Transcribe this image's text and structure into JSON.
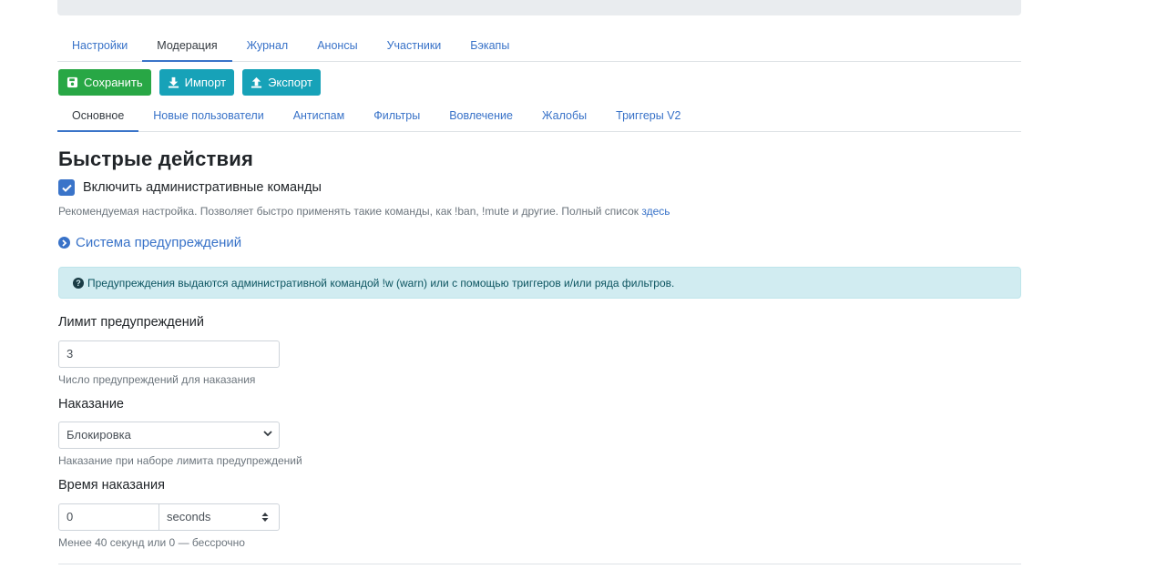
{
  "main_tabs": [
    {
      "label": "Настройки",
      "active": false
    },
    {
      "label": "Модерация",
      "active": true
    },
    {
      "label": "Журнал",
      "active": false
    },
    {
      "label": "Анонсы",
      "active": false
    },
    {
      "label": "Участники",
      "active": false
    },
    {
      "label": "Бэкапы",
      "active": false
    }
  ],
  "toolbar": {
    "save_label": "Сохранить",
    "import_label": "Импорт",
    "export_label": "Экспорт"
  },
  "sub_tabs": [
    {
      "label": "Основное",
      "active": true
    },
    {
      "label": "Новые пользователи",
      "active": false
    },
    {
      "label": "Антиспам",
      "active": false
    },
    {
      "label": "Фильтры",
      "active": false
    },
    {
      "label": "Вовлечение",
      "active": false
    },
    {
      "label": "Жалобы",
      "active": false
    },
    {
      "label": "Триггеры V2",
      "active": false
    }
  ],
  "quick_actions": {
    "heading": "Быстрые действия",
    "admin_commands_label": "Включить административные команды",
    "admin_commands_checked": true,
    "hint_text": "Рекомендуемая настройка. Позволяет быстро применять такие команды, как !ban, !mute и другие. Полный список ",
    "hint_link": "здесь"
  },
  "warnings": {
    "section_link": "Система предупреждений",
    "alert_text": "Предупреждения выдаются административной командой !w (warn) или с помощью триггеров и/или ряда фильтров.",
    "limit_label": "Лимит предупреждений",
    "limit_value": "3",
    "limit_hint": "Число предупреждений для наказания",
    "punishment_label": "Наказание",
    "punishment_value": "Блокировка",
    "punishment_hint": "Наказание при наборе лимита предупреждений",
    "duration_label": "Время наказания",
    "duration_value": "0",
    "duration_unit": "seconds",
    "duration_hint": "Менее 40 секунд или 0 — бессрочно"
  },
  "colors": {
    "accent": "#3a74c9",
    "success": "#28a745",
    "info": "#17a2b8",
    "alert_bg": "#d1ecf1"
  }
}
